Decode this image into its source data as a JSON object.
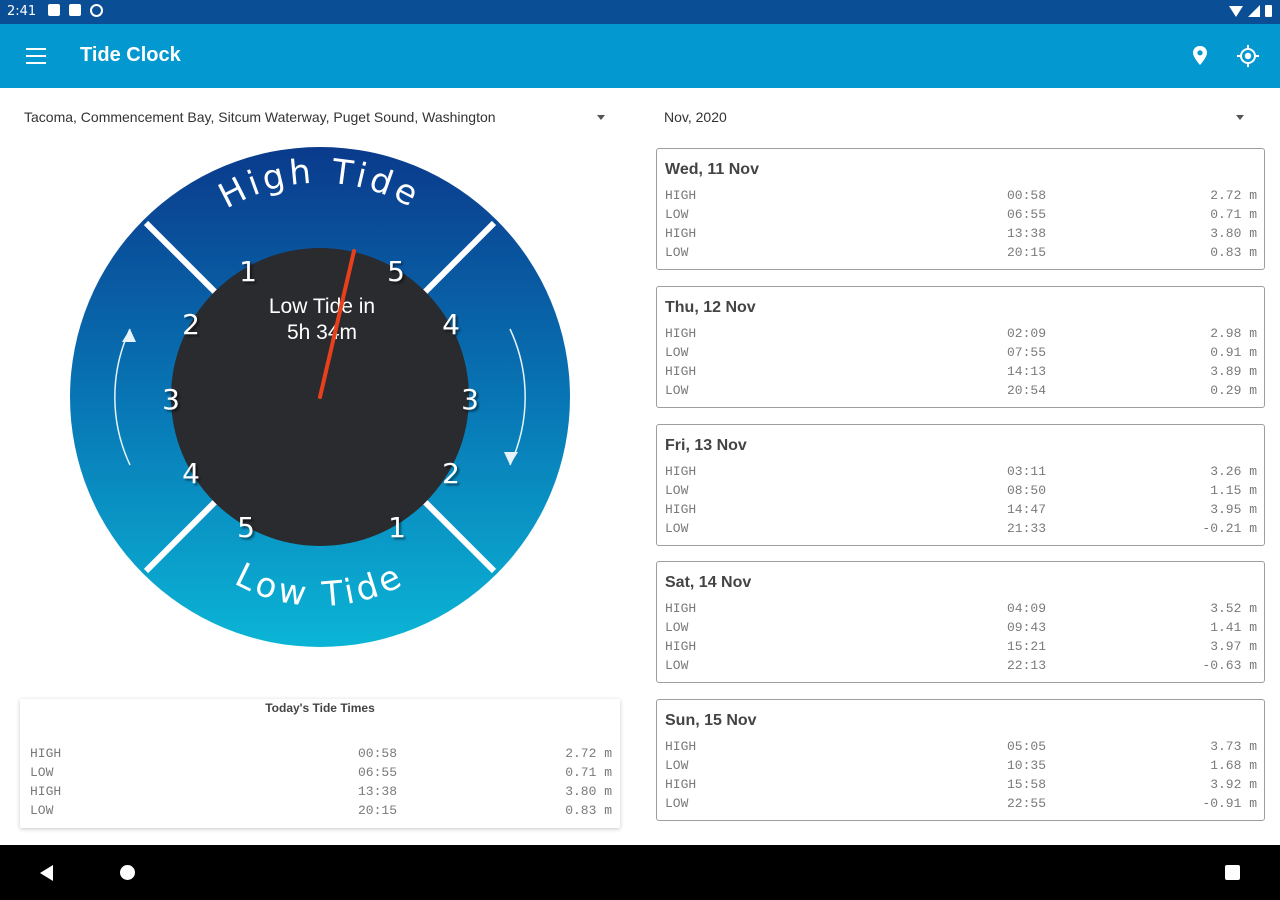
{
  "status_bar": {
    "time": "2:41"
  },
  "app_bar": {
    "title": "Tide Clock"
  },
  "location": {
    "selected": "Tacoma, Commencement Bay, Sitcum Waterway, Puget Sound, Washington"
  },
  "month": {
    "selected": "Nov, 2020"
  },
  "clock": {
    "top_label": "High Tide",
    "bottom_label": "Low Tide",
    "center_line1": "Low Tide in",
    "center_line2": "5h 34m",
    "hand_color": "#e8401c",
    "hour_numbers": [
      "1",
      "5",
      "2",
      "4",
      "3",
      "3",
      "4",
      "2",
      "5",
      "1"
    ]
  },
  "today": {
    "title": "Today's Tide Times",
    "rows": [
      {
        "type": "HIGH",
        "time": "00:58",
        "height": "2.72 m"
      },
      {
        "type": "LOW",
        "time": "06:55",
        "height": "0.71 m"
      },
      {
        "type": "HIGH",
        "time": "13:38",
        "height": "3.80 m"
      },
      {
        "type": "LOW",
        "time": "20:15",
        "height": "0.83 m"
      }
    ]
  },
  "days": [
    {
      "title": "Wed, 11 Nov",
      "rows": [
        {
          "type": "HIGH",
          "time": "00:58",
          "height": "2.72 m"
        },
        {
          "type": "LOW",
          "time": "06:55",
          "height": "0.71 m"
        },
        {
          "type": "HIGH",
          "time": "13:38",
          "height": "3.80 m"
        },
        {
          "type": "LOW",
          "time": "20:15",
          "height": "0.83 m"
        }
      ]
    },
    {
      "title": "Thu, 12 Nov",
      "rows": [
        {
          "type": "HIGH",
          "time": "02:09",
          "height": "2.98 m"
        },
        {
          "type": "LOW",
          "time": "07:55",
          "height": "0.91 m"
        },
        {
          "type": "HIGH",
          "time": "14:13",
          "height": "3.89 m"
        },
        {
          "type": "LOW",
          "time": "20:54",
          "height": "0.29 m"
        }
      ]
    },
    {
      "title": "Fri, 13 Nov",
      "rows": [
        {
          "type": "HIGH",
          "time": "03:11",
          "height": "3.26 m"
        },
        {
          "type": "LOW",
          "time": "08:50",
          "height": "1.15 m"
        },
        {
          "type": "HIGH",
          "time": "14:47",
          "height": "3.95 m"
        },
        {
          "type": "LOW",
          "time": "21:33",
          "height": "-0.21 m"
        }
      ]
    },
    {
      "title": "Sat, 14 Nov",
      "rows": [
        {
          "type": "HIGH",
          "time": "04:09",
          "height": "3.52 m"
        },
        {
          "type": "LOW",
          "time": "09:43",
          "height": "1.41 m"
        },
        {
          "type": "HIGH",
          "time": "15:21",
          "height": "3.97 m"
        },
        {
          "type": "LOW",
          "time": "22:13",
          "height": "-0.63 m"
        }
      ]
    },
    {
      "title": "Sun, 15 Nov",
      "rows": [
        {
          "type": "HIGH",
          "time": "05:05",
          "height": "3.73 m"
        },
        {
          "type": "LOW",
          "time": "10:35",
          "height": "1.68 m"
        },
        {
          "type": "HIGH",
          "time": "15:58",
          "height": "3.92 m"
        },
        {
          "type": "LOW",
          "time": "22:55",
          "height": "-0.91 m"
        }
      ]
    }
  ],
  "icons": {
    "menu": "menu-icon",
    "pin": "location-pin-icon",
    "gps": "my-location-icon",
    "back": "back-icon",
    "home": "home-icon",
    "recents": "recents-icon"
  },
  "colors": {
    "status_bar": "#0a4f95",
    "app_bar": "#0398cf",
    "dial_top": "#0a3a8c",
    "dial_bottom": "#0bb5d6",
    "dial_center": "#2a2b2f"
  }
}
